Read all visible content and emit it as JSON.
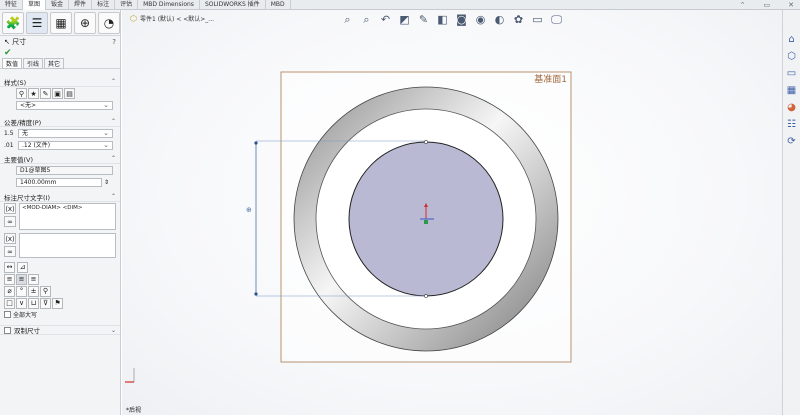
{
  "tabs": [
    "特征",
    "草图",
    "钣金",
    "焊件",
    "标注",
    "评估",
    "MBD Dimensions",
    "SOLIDWORKS 插件",
    "MBD"
  ],
  "active_tab_index": 1,
  "window_controls": [
    "⌃",
    "▭",
    "✕"
  ],
  "breadcrumb": {
    "text": "零件1 (默认) < <默认>_..."
  },
  "panel": {
    "title": "尺寸",
    "help": "?",
    "ok": "✔",
    "subtabs": [
      "数值",
      "引线",
      "其它"
    ],
    "style": {
      "header": "样式(S)",
      "value": "<无>"
    },
    "tolerance": {
      "header": "公差/精度(P)",
      "tol_type": "无",
      "precision": ".12 (文件)"
    },
    "primary": {
      "header": "主要值(V)",
      "name": "D1@草图5",
      "value": "1400.00mm"
    },
    "dimtext": {
      "header": "标注尺寸文字(I)",
      "text": "<MOD-DIAM> <DIM>",
      "checkbox": "全部大写"
    },
    "dual": "双制尺寸"
  },
  "plane_label": "基准面1",
  "bottom_label": "*后视",
  "colors": {
    "plane_border": "#b79271",
    "plane_label": "#a0683c",
    "ring_dark": "#7d7d7d",
    "disk_fill": "#b9b9d3",
    "dim_line": "#4d6ea8"
  },
  "toolbar_icons": [
    "zoom-fit-icon",
    "zoom-area-icon",
    "previous-view-icon",
    "section-view-icon",
    "dynamic-annotation-icon",
    "view-orientation-icon",
    "display-style-icon",
    "hide-show-icon",
    "edit-appearance-icon",
    "apply-scene-icon",
    "view-settings-icon",
    "monitor-icon"
  ],
  "right_icons": [
    "home-icon",
    "part-icon",
    "folder-icon",
    "palette-icon",
    "appearance-icon",
    "custom-props-icon",
    "refresh-icon"
  ]
}
